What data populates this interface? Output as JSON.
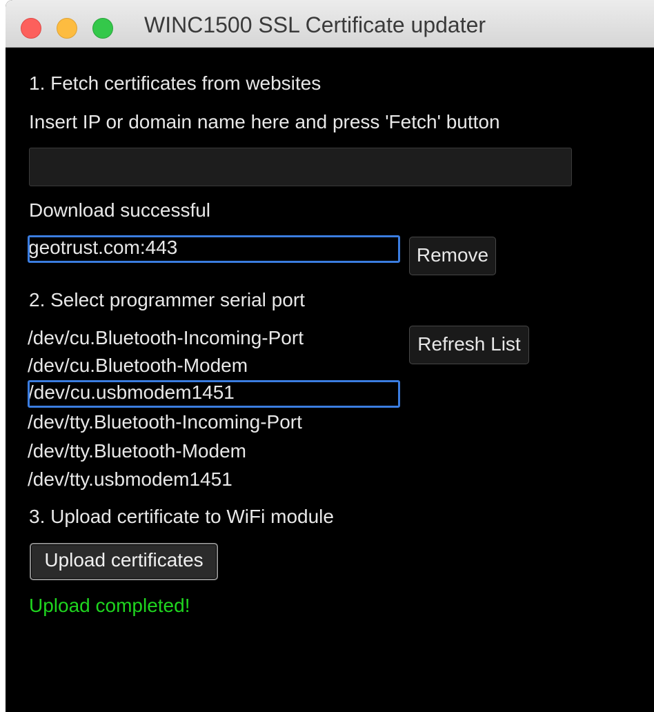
{
  "window": {
    "title": "WINC1500 SSL Certificate updater"
  },
  "fetch_section": {
    "heading": "1. Fetch certificates from websites",
    "instruction": "Insert IP or domain name here and press 'Fetch' button",
    "input_value": "",
    "status": "Download successful",
    "selected_site": "geotrust.com:443",
    "remove_label": "Remove"
  },
  "port_section": {
    "heading": "2. Select programmer serial port",
    "refresh_label": "Refresh List",
    "ports": [
      "/dev/cu.Bluetooth-Incoming-Port",
      "/dev/cu.Bluetooth-Modem",
      "/dev/cu.usbmodem1451",
      "/dev/tty.Bluetooth-Incoming-Port",
      "/dev/tty.Bluetooth-Modem",
      "/dev/tty.usbmodem1451"
    ],
    "selected_port": "/dev/cu.usbmodem1451"
  },
  "upload_section": {
    "heading": "3. Upload certificate to WiFi module",
    "upload_label": "Upload certificates",
    "status": "Upload completed!"
  },
  "colors": {
    "selection_border": "#3b7de0",
    "success_text": "#1fd51f",
    "background": "#000000"
  }
}
